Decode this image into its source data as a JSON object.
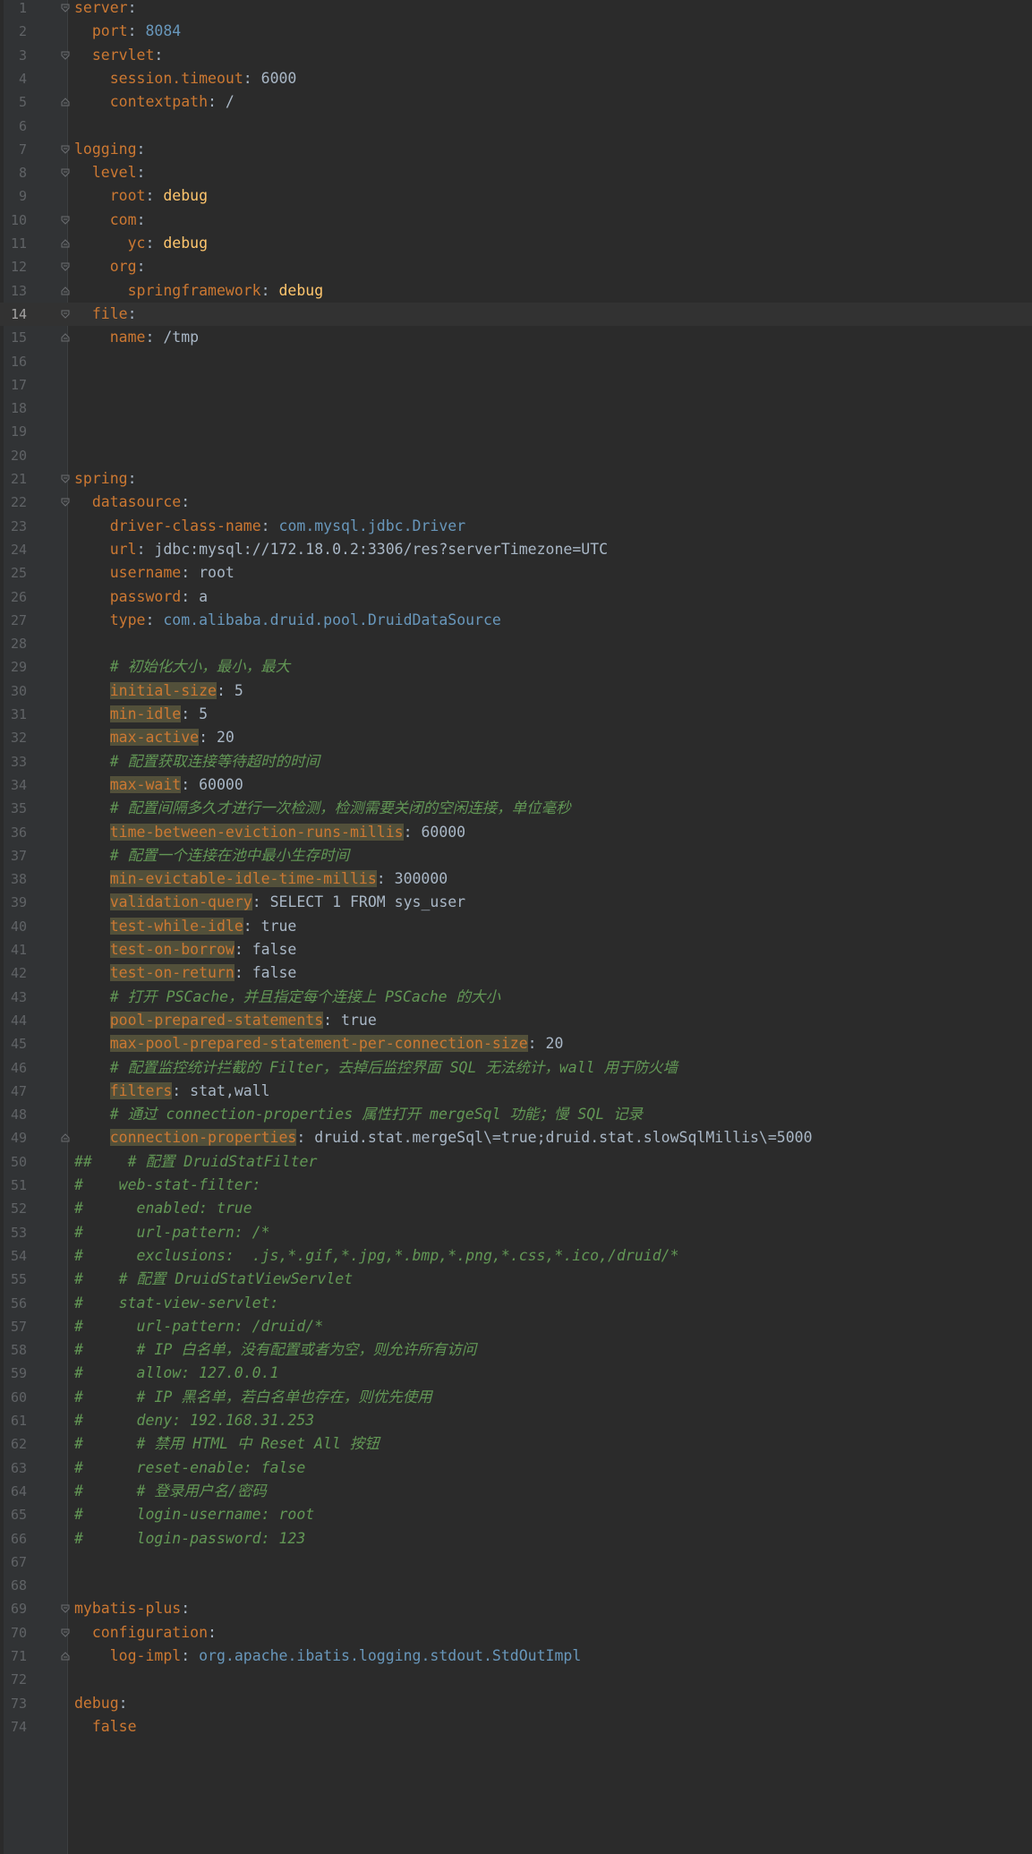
{
  "editor": {
    "current_line": 14,
    "lines": [
      {
        "n": "1",
        "fold": "open",
        "segs": [
          {
            "c": "k",
            "t": "server"
          },
          {
            "c": "v",
            "t": ":"
          }
        ]
      },
      {
        "n": "2",
        "fold": "",
        "segs": [
          {
            "c": "v",
            "t": "  "
          },
          {
            "c": "k",
            "t": "port"
          },
          {
            "c": "v",
            "t": ": "
          },
          {
            "c": "n",
            "t": "8084"
          }
        ]
      },
      {
        "n": "3",
        "fold": "open",
        "segs": [
          {
            "c": "v",
            "t": "  "
          },
          {
            "c": "k",
            "t": "servlet"
          },
          {
            "c": "v",
            "t": ":"
          }
        ]
      },
      {
        "n": "4",
        "fold": "",
        "segs": [
          {
            "c": "v",
            "t": "    "
          },
          {
            "c": "k",
            "t": "session.timeout"
          },
          {
            "c": "v",
            "t": ": 6000"
          }
        ]
      },
      {
        "n": "5",
        "fold": "close",
        "segs": [
          {
            "c": "v",
            "t": "    "
          },
          {
            "c": "k",
            "t": "contextpath"
          },
          {
            "c": "v",
            "t": ": /"
          }
        ]
      },
      {
        "n": "6",
        "fold": "",
        "segs": []
      },
      {
        "n": "7",
        "fold": "open",
        "segs": [
          {
            "c": "k",
            "t": "logging"
          },
          {
            "c": "v",
            "t": ":"
          }
        ]
      },
      {
        "n": "8",
        "fold": "open",
        "segs": [
          {
            "c": "v",
            "t": "  "
          },
          {
            "c": "k",
            "t": "level"
          },
          {
            "c": "v",
            "t": ":"
          }
        ]
      },
      {
        "n": "9",
        "fold": "",
        "segs": [
          {
            "c": "v",
            "t": "    "
          },
          {
            "c": "k",
            "t": "root"
          },
          {
            "c": "v",
            "t": ": "
          },
          {
            "c": "vb",
            "t": "debug"
          }
        ]
      },
      {
        "n": "10",
        "fold": "open",
        "segs": [
          {
            "c": "v",
            "t": "    "
          },
          {
            "c": "k",
            "t": "com"
          },
          {
            "c": "v",
            "t": ":"
          }
        ]
      },
      {
        "n": "11",
        "fold": "close",
        "segs": [
          {
            "c": "v",
            "t": "      "
          },
          {
            "c": "k",
            "t": "yc"
          },
          {
            "c": "v",
            "t": ": "
          },
          {
            "c": "vb",
            "t": "debug"
          }
        ]
      },
      {
        "n": "12",
        "fold": "open",
        "segs": [
          {
            "c": "v",
            "t": "    "
          },
          {
            "c": "k",
            "t": "org"
          },
          {
            "c": "v",
            "t": ":"
          }
        ]
      },
      {
        "n": "13",
        "fold": "close",
        "segs": [
          {
            "c": "v",
            "t": "      "
          },
          {
            "c": "k",
            "t": "springframework"
          },
          {
            "c": "v",
            "t": ": "
          },
          {
            "c": "vb",
            "t": "debug"
          }
        ]
      },
      {
        "n": "14",
        "fold": "open",
        "segs": [
          {
            "c": "v",
            "t": "  "
          },
          {
            "c": "k",
            "t": "file"
          },
          {
            "c": "v",
            "t": ":"
          }
        ]
      },
      {
        "n": "15",
        "fold": "close",
        "segs": [
          {
            "c": "v",
            "t": "    "
          },
          {
            "c": "k",
            "t": "name"
          },
          {
            "c": "v",
            "t": ": /tmp"
          }
        ]
      },
      {
        "n": "16",
        "fold": "",
        "segs": []
      },
      {
        "n": "17",
        "fold": "",
        "segs": []
      },
      {
        "n": "18",
        "fold": "",
        "segs": []
      },
      {
        "n": "19",
        "fold": "",
        "segs": []
      },
      {
        "n": "20",
        "fold": "",
        "segs": []
      },
      {
        "n": "21",
        "fold": "open",
        "segs": [
          {
            "c": "k",
            "t": "spring"
          },
          {
            "c": "v",
            "t": ":"
          }
        ]
      },
      {
        "n": "22",
        "fold": "open",
        "segs": [
          {
            "c": "v",
            "t": "  "
          },
          {
            "c": "k",
            "t": "datasource"
          },
          {
            "c": "v",
            "t": ":"
          }
        ]
      },
      {
        "n": "23",
        "fold": "",
        "segs": [
          {
            "c": "v",
            "t": "    "
          },
          {
            "c": "k",
            "t": "driver-class-name"
          },
          {
            "c": "v",
            "t": ": "
          },
          {
            "c": "pk",
            "t": "com.mysql.jdbc.Driver"
          }
        ]
      },
      {
        "n": "24",
        "fold": "",
        "segs": [
          {
            "c": "v",
            "t": "    "
          },
          {
            "c": "k",
            "t": "url"
          },
          {
            "c": "v",
            "t": ": jdbc:mysql://172.18.0.2:3306/res?serverTimezone=UTC"
          }
        ]
      },
      {
        "n": "25",
        "fold": "",
        "segs": [
          {
            "c": "v",
            "t": "    "
          },
          {
            "c": "k",
            "t": "username"
          },
          {
            "c": "v",
            "t": ": root"
          }
        ]
      },
      {
        "n": "26",
        "fold": "",
        "segs": [
          {
            "c": "v",
            "t": "    "
          },
          {
            "c": "k",
            "t": "password"
          },
          {
            "c": "v",
            "t": ": a"
          }
        ]
      },
      {
        "n": "27",
        "fold": "",
        "segs": [
          {
            "c": "v",
            "t": "    "
          },
          {
            "c": "k",
            "t": "type"
          },
          {
            "c": "v",
            "t": ": "
          },
          {
            "c": "pk",
            "t": "com.alibaba.druid.pool.DruidDataSource"
          }
        ]
      },
      {
        "n": "28",
        "fold": "",
        "segs": []
      },
      {
        "n": "29",
        "fold": "",
        "segs": [
          {
            "c": "v",
            "t": "    "
          },
          {
            "c": "c",
            "t": "# 初始化大小，最小，最大"
          }
        ]
      },
      {
        "n": "30",
        "fold": "",
        "segs": [
          {
            "c": "v",
            "t": "    "
          },
          {
            "c": "k hl",
            "t": "initial-size"
          },
          {
            "c": "v",
            "t": ": 5"
          }
        ]
      },
      {
        "n": "31",
        "fold": "",
        "segs": [
          {
            "c": "v",
            "t": "    "
          },
          {
            "c": "k hl",
            "t": "min-idle"
          },
          {
            "c": "v",
            "t": ": 5"
          }
        ]
      },
      {
        "n": "32",
        "fold": "",
        "segs": [
          {
            "c": "v",
            "t": "    "
          },
          {
            "c": "k hl",
            "t": "max-active"
          },
          {
            "c": "v",
            "t": ": 20"
          }
        ]
      },
      {
        "n": "33",
        "fold": "",
        "segs": [
          {
            "c": "v",
            "t": "    "
          },
          {
            "c": "c",
            "t": "# 配置获取连接等待超时的时间"
          }
        ]
      },
      {
        "n": "34",
        "fold": "",
        "segs": [
          {
            "c": "v",
            "t": "    "
          },
          {
            "c": "k hl",
            "t": "max-wait"
          },
          {
            "c": "v",
            "t": ": 60000"
          }
        ]
      },
      {
        "n": "35",
        "fold": "",
        "segs": [
          {
            "c": "v",
            "t": "    "
          },
          {
            "c": "c",
            "t": "# 配置间隔多久才进行一次检测，检测需要关闭的空闲连接，单位毫秒"
          }
        ]
      },
      {
        "n": "36",
        "fold": "",
        "segs": [
          {
            "c": "v",
            "t": "    "
          },
          {
            "c": "k hl",
            "t": "time-between-eviction-runs-millis"
          },
          {
            "c": "v",
            "t": ": 60000"
          }
        ]
      },
      {
        "n": "37",
        "fold": "",
        "segs": [
          {
            "c": "v",
            "t": "    "
          },
          {
            "c": "c",
            "t": "# 配置一个连接在池中最小生存时间"
          }
        ]
      },
      {
        "n": "38",
        "fold": "",
        "segs": [
          {
            "c": "v",
            "t": "    "
          },
          {
            "c": "k hl",
            "t": "min-evictable-idle-time-millis"
          },
          {
            "c": "v",
            "t": ": 300000"
          }
        ]
      },
      {
        "n": "39",
        "fold": "",
        "segs": [
          {
            "c": "v",
            "t": "    "
          },
          {
            "c": "k hl",
            "t": "validation-query"
          },
          {
            "c": "v",
            "t": ": SELECT 1 FROM sys_user"
          }
        ]
      },
      {
        "n": "40",
        "fold": "",
        "segs": [
          {
            "c": "v",
            "t": "    "
          },
          {
            "c": "k hl",
            "t": "test-while-idle"
          },
          {
            "c": "v",
            "t": ": true"
          }
        ]
      },
      {
        "n": "41",
        "fold": "",
        "segs": [
          {
            "c": "v",
            "t": "    "
          },
          {
            "c": "k hl",
            "t": "test-on-borrow"
          },
          {
            "c": "v",
            "t": ": false"
          }
        ]
      },
      {
        "n": "42",
        "fold": "",
        "segs": [
          {
            "c": "v",
            "t": "    "
          },
          {
            "c": "k hl",
            "t": "test-on-return"
          },
          {
            "c": "v",
            "t": ": false"
          }
        ]
      },
      {
        "n": "43",
        "fold": "",
        "segs": [
          {
            "c": "v",
            "t": "    "
          },
          {
            "c": "c",
            "t": "# 打开 PSCache，并且指定每个连接上 PSCache 的大小"
          }
        ]
      },
      {
        "n": "44",
        "fold": "",
        "segs": [
          {
            "c": "v",
            "t": "    "
          },
          {
            "c": "k hl",
            "t": "pool-prepared-statements"
          },
          {
            "c": "v",
            "t": ": true"
          }
        ]
      },
      {
        "n": "45",
        "fold": "",
        "segs": [
          {
            "c": "v",
            "t": "    "
          },
          {
            "c": "k hl",
            "t": "max-pool-prepared-statement-per-connection-size"
          },
          {
            "c": "v",
            "t": ": 20"
          }
        ]
      },
      {
        "n": "46",
        "fold": "",
        "segs": [
          {
            "c": "v",
            "t": "    "
          },
          {
            "c": "c",
            "t": "# 配置监控统计拦截的 Filter，去掉后监控界面 SQL 无法统计，wall 用于防火墙"
          }
        ]
      },
      {
        "n": "47",
        "fold": "",
        "segs": [
          {
            "c": "v",
            "t": "    "
          },
          {
            "c": "k hl",
            "t": "filters"
          },
          {
            "c": "v",
            "t": ": stat,wall"
          }
        ]
      },
      {
        "n": "48",
        "fold": "",
        "segs": [
          {
            "c": "v",
            "t": "    "
          },
          {
            "c": "c",
            "t": "# 通过 connection-properties 属性打开 mergeSql 功能；慢 SQL 记录"
          }
        ]
      },
      {
        "n": "49",
        "fold": "close",
        "segs": [
          {
            "c": "v",
            "t": "    "
          },
          {
            "c": "k hl",
            "t": "connection-properties"
          },
          {
            "c": "v",
            "t": ": druid.stat.mergeSql\\=true;druid.stat.slowSqlMillis\\=5000"
          }
        ]
      },
      {
        "n": "50",
        "fold": "",
        "segs": [
          {
            "c": "c",
            "t": "##    # 配置 DruidStatFilter"
          }
        ]
      },
      {
        "n": "51",
        "fold": "",
        "segs": [
          {
            "c": "c",
            "t": "#    web-stat-filter:"
          }
        ]
      },
      {
        "n": "52",
        "fold": "",
        "segs": [
          {
            "c": "c",
            "t": "#      enabled: true"
          }
        ]
      },
      {
        "n": "53",
        "fold": "",
        "segs": [
          {
            "c": "c",
            "t": "#      url-pattern: /*"
          }
        ]
      },
      {
        "n": "54",
        "fold": "",
        "segs": [
          {
            "c": "c",
            "t": "#      exclusions:  .js,*.gif,*.jpg,*.bmp,*.png,*.css,*.ico,/druid/*"
          }
        ]
      },
      {
        "n": "55",
        "fold": "",
        "segs": [
          {
            "c": "c",
            "t": "#    # 配置 DruidStatViewServlet"
          }
        ]
      },
      {
        "n": "56",
        "fold": "",
        "segs": [
          {
            "c": "c",
            "t": "#    stat-view-servlet:"
          }
        ]
      },
      {
        "n": "57",
        "fold": "",
        "segs": [
          {
            "c": "c",
            "t": "#      url-pattern: /druid/*"
          }
        ]
      },
      {
        "n": "58",
        "fold": "",
        "segs": [
          {
            "c": "c",
            "t": "#      # IP 白名单，没有配置或者为空，则允许所有访问"
          }
        ]
      },
      {
        "n": "59",
        "fold": "",
        "segs": [
          {
            "c": "c",
            "t": "#      allow: 127.0.0.1"
          }
        ]
      },
      {
        "n": "60",
        "fold": "",
        "segs": [
          {
            "c": "c",
            "t": "#      # IP 黑名单，若白名单也存在，则优先使用"
          }
        ]
      },
      {
        "n": "61",
        "fold": "",
        "segs": [
          {
            "c": "c",
            "t": "#      deny: 192.168.31.253"
          }
        ]
      },
      {
        "n": "62",
        "fold": "",
        "segs": [
          {
            "c": "c",
            "t": "#      # 禁用 HTML 中 Reset All 按钮"
          }
        ]
      },
      {
        "n": "63",
        "fold": "",
        "segs": [
          {
            "c": "c",
            "t": "#      reset-enable: false"
          }
        ]
      },
      {
        "n": "64",
        "fold": "",
        "segs": [
          {
            "c": "c",
            "t": "#      # 登录用户名/密码"
          }
        ]
      },
      {
        "n": "65",
        "fold": "",
        "segs": [
          {
            "c": "c",
            "t": "#      login-username: root"
          }
        ]
      },
      {
        "n": "66",
        "fold": "",
        "segs": [
          {
            "c": "c",
            "t": "#      login-password: 123"
          }
        ]
      },
      {
        "n": "67",
        "fold": "",
        "segs": []
      },
      {
        "n": "68",
        "fold": "",
        "segs": []
      },
      {
        "n": "69",
        "fold": "open",
        "segs": [
          {
            "c": "k",
            "t": "mybatis-plus"
          },
          {
            "c": "v",
            "t": ":"
          }
        ]
      },
      {
        "n": "70",
        "fold": "open",
        "segs": [
          {
            "c": "v",
            "t": "  "
          },
          {
            "c": "k",
            "t": "configuration"
          },
          {
            "c": "v",
            "t": ":"
          }
        ]
      },
      {
        "n": "71",
        "fold": "close",
        "segs": [
          {
            "c": "v",
            "t": "    "
          },
          {
            "c": "k",
            "t": "log-impl"
          },
          {
            "c": "v",
            "t": ": "
          },
          {
            "c": "pk",
            "t": "org.apache.ibatis.logging.stdout.StdOutImpl"
          }
        ]
      },
      {
        "n": "72",
        "fold": "",
        "segs": []
      },
      {
        "n": "73",
        "fold": "",
        "segs": [
          {
            "c": "k",
            "t": "debug"
          },
          {
            "c": "v",
            "t": ":"
          }
        ]
      },
      {
        "n": "74",
        "fold": "",
        "segs": [
          {
            "c": "v",
            "t": "  "
          },
          {
            "c": "k",
            "t": "false"
          }
        ]
      }
    ]
  }
}
